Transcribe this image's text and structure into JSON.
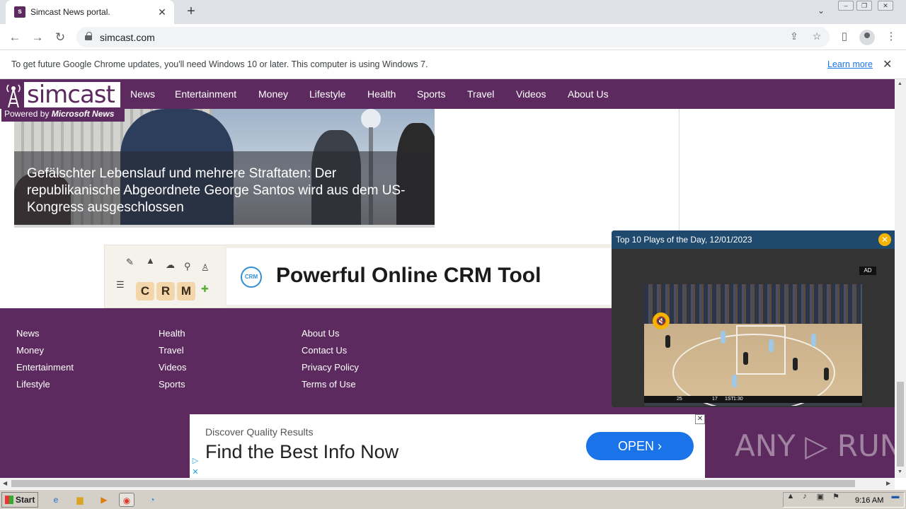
{
  "browser": {
    "tab_title": "Simcast News portal.",
    "tab_close": "✕",
    "new_tab": "+",
    "url": "simcast.com",
    "infobar_text": "To get future Google Chrome updates, you'll need Windows 10 or later. This computer is using Windows 7.",
    "infobar_link": "Learn more",
    "infobar_close": "✕"
  },
  "site": {
    "logo_word": "simcast",
    "powered_by_prefix": "Powered by",
    "powered_by_brand": "Microsoft News",
    "nav": [
      "News",
      "Entertainment",
      "Money",
      "Lifestyle",
      "Health",
      "Sports",
      "Travel",
      "Videos",
      "About Us"
    ],
    "hero_title": "Gefälschter Lebenslauf und mehrere Straftaten: Der republikanische Abgeordnete George Santos wird aus dem US-Kongress ausgeschlossen"
  },
  "crm_ad": {
    "dice": [
      "C",
      "R",
      "M"
    ],
    "badge": "CRM",
    "title": "Powerful Online CRM Tool"
  },
  "footer": {
    "col1": [
      "News",
      "Money",
      "Entertainment",
      "Lifestyle"
    ],
    "col2": [
      "Health",
      "Travel",
      "Videos",
      "Sports"
    ],
    "col3": [
      "About Us",
      "Contact Us",
      "Privacy Policy",
      "Terms of Use"
    ]
  },
  "video_ad": {
    "title": "Top 10 Plays of the Day, 12/01/2023",
    "ad_label": "AD",
    "close": "✕",
    "score_left": "25",
    "score_right": "17",
    "period": "1ST",
    "clock": "1:30"
  },
  "bottom_ad": {
    "small": "Discover Quality Results",
    "big": "Find the Best Info Now",
    "cta": "OPEN",
    "cta_arrow": "›",
    "close": "✕"
  },
  "watermark": "ANY ▷ RUN",
  "taskbar": {
    "start": "Start",
    "clock": "9:16 AM"
  },
  "colors": {
    "brand": "#5c2a5e",
    "accent_blue": "#1a73e8",
    "video_accent": "#f5b400"
  },
  "icons": [
    "back-icon",
    "forward-icon",
    "reload-icon",
    "lock-icon",
    "share-icon",
    "star-icon",
    "sidebar-icon",
    "profile-icon",
    "menu-icon"
  ]
}
